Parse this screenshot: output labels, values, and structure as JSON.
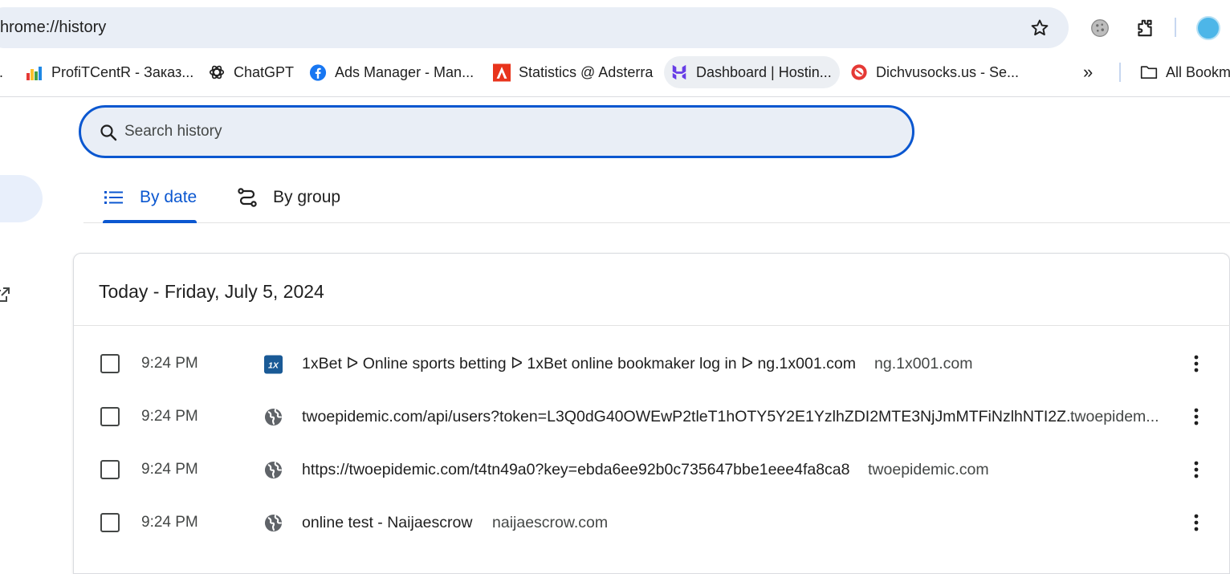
{
  "omnibox": {
    "url": "hrome://history"
  },
  "bookmarks": [
    {
      "label": "ProfiTCentR - Заказ...",
      "icon": "bar-chart-icon"
    },
    {
      "label": "ChatGPT",
      "icon": "chatgpt-icon"
    },
    {
      "label": "Ads Manager - Man...",
      "icon": "facebook-icon"
    },
    {
      "label": "Statistics @ Adsterra",
      "icon": "adsterra-icon"
    },
    {
      "label": "Dashboard | Hostin...",
      "icon": "hostinger-icon"
    },
    {
      "label": "Dichvusocks.us - Se...",
      "icon": "dichvusocks-icon"
    }
  ],
  "bookmarks_overflow": "»",
  "all_bookmarks_label": "All Bookm",
  "search": {
    "placeholder": "Search history",
    "value": ""
  },
  "tabs": [
    {
      "label": "By date",
      "icon": "list-icon",
      "selected": true
    },
    {
      "label": "By group",
      "icon": "group-icon",
      "selected": false
    }
  ],
  "history": {
    "date_heading": "Today - Friday, July 5, 2024",
    "entries": [
      {
        "time": "9:24 PM",
        "title": "1xBet ᐅ Online sports betting ᐅ 1xBet online bookmaker log in ᐅ ng.1x001.com",
        "domain": "ng.1x001.com",
        "icon": "1xbet-icon"
      },
      {
        "time": "9:24 PM",
        "title": "twoepidemic.com/api/users?token=L3Q0dG40OWEwP2tleT1hOTY5Y2E1YzlhZDI2MTE3NjJmMTFiNzlhNTI2Z...",
        "domain": "twoepidem...",
        "icon": "globe-icon"
      },
      {
        "time": "9:24 PM",
        "title": "https://twoepidemic.com/t4tn49a0?key=ebda6ee92b0c735647bbe1eee4fa8ca8",
        "domain": "twoepidemic.com",
        "icon": "globe-icon"
      },
      {
        "time": "9:24 PM",
        "title": "online test - Naijaescrow",
        "domain": "naijaescrow.com",
        "icon": "globe-icon"
      }
    ]
  },
  "colors": {
    "accent": "#0b57d0",
    "omnibox_bg": "#e9eef6"
  }
}
